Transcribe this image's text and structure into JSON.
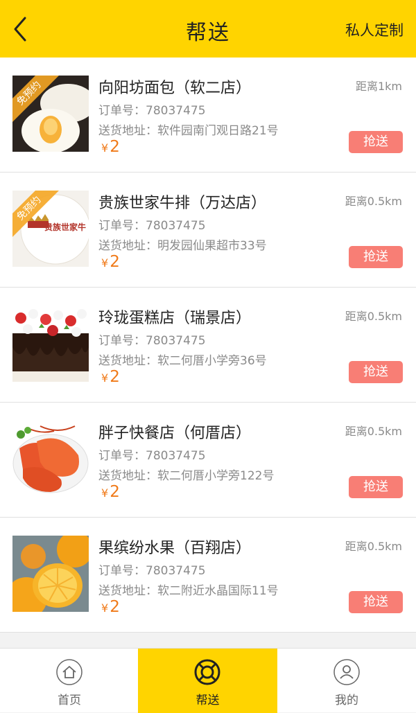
{
  "header": {
    "title": "帮送",
    "action_label": "私人定制"
  },
  "orders": [
    {
      "shop_name": "向阳坊面包（软二店）",
      "order_no": "订单号：78037475",
      "address": "送货地址：软件园南门观日路21号",
      "currency": "¥",
      "price": "2",
      "distance": "距离1km",
      "button_label": "抢送",
      "badge": "免预约",
      "image": "bread-photo"
    },
    {
      "shop_name": "贵族世家牛排（万达店）",
      "order_no": "订单号：78037475",
      "address": "送货地址：明发园仙果超市33号",
      "currency": "¥",
      "price": "2",
      "distance": "距离0.5km",
      "button_label": "抢送",
      "badge": "免预约",
      "image": "steak-logo",
      "logo_text": "贵族世家牛"
    },
    {
      "shop_name": "玲珑蛋糕店（瑞景店）",
      "order_no": "订单号：78037475",
      "address": "送货地址：软二何厝小学旁36号",
      "currency": "¥",
      "price": "2",
      "distance": "距离0.5km",
      "button_label": "抢送",
      "image": "cake-photo"
    },
    {
      "shop_name": "胖子快餐店（何厝店）",
      "order_no": "订单号：78037475",
      "address": "送货地址：软二何厝小学旁122号",
      "currency": "¥",
      "price": "2",
      "distance": "距离0.5km",
      "button_label": "抢送",
      "image": "shrimp-photo"
    },
    {
      "shop_name": "果缤纷水果（百翔店）",
      "order_no": "订单号：78037475",
      "address": "送货地址：软二附近水晶国际11号",
      "currency": "¥",
      "price": "2",
      "distance": "距离0.5km",
      "button_label": "抢送",
      "image": "orange-photo"
    }
  ],
  "tabs": [
    {
      "label": "首页",
      "icon": "home-icon"
    },
    {
      "label": "帮送",
      "icon": "lifebuoy-icon",
      "active": true
    },
    {
      "label": "我的",
      "icon": "user-icon"
    }
  ],
  "colors": {
    "brand_yellow": "#ffd400",
    "price_orange": "#f07a19",
    "button_red": "#f87e75",
    "badge_orange": "#f5a623"
  }
}
